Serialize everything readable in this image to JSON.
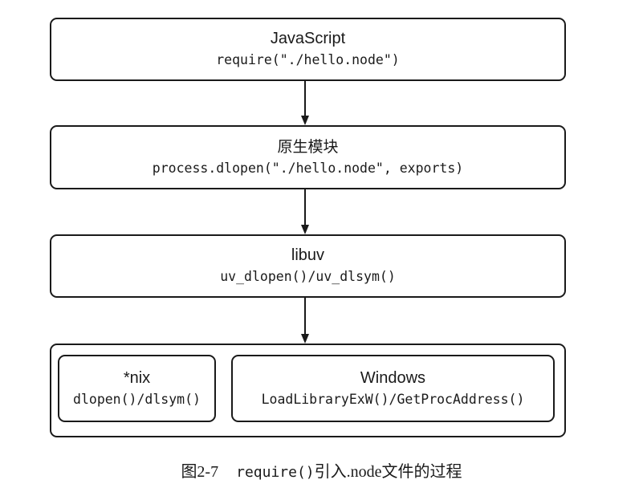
{
  "diagram": {
    "layers": [
      {
        "title": "JavaScript",
        "code": "require(\"./hello.node\")"
      },
      {
        "title": "原生模块",
        "code": "process.dlopen(\"./hello.node\", exports)"
      },
      {
        "title": "libuv",
        "code": "uv_dlopen()/uv_dlsym()"
      }
    ],
    "platforms": [
      {
        "title": "*nix",
        "code": "dlopen()/dlsym()"
      },
      {
        "title": "Windows",
        "code": "LoadLibraryExW()/GetProcAddress()"
      }
    ]
  },
  "caption": {
    "figure_number": "图2-7",
    "code": "require()",
    "text": "引入.node文件的过程"
  }
}
